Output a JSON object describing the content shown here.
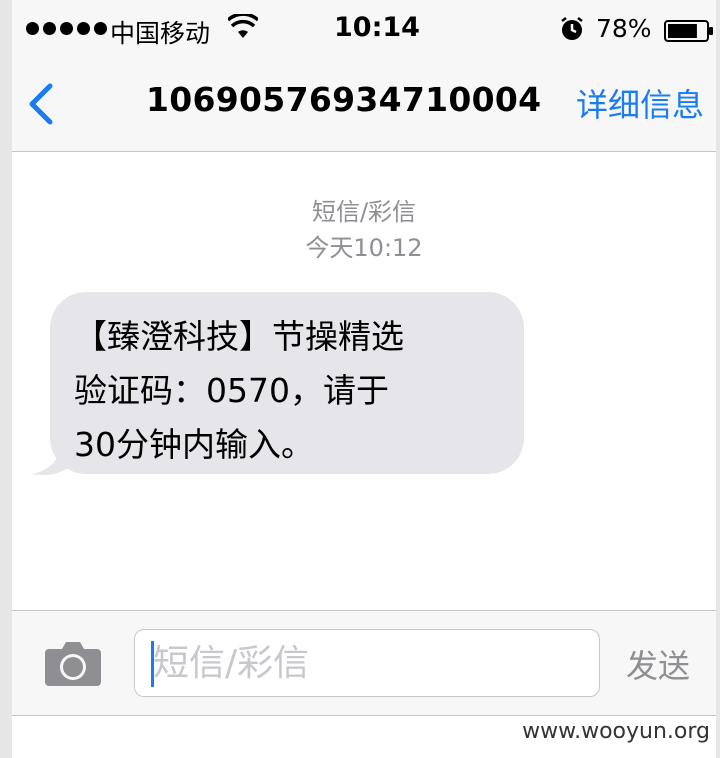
{
  "status_bar": {
    "carrier": "中国移动",
    "time": "10:14",
    "battery_percent": "78%",
    "battery_level": 0.78,
    "icons": [
      "signal-dots-icon",
      "wifi-icon",
      "alarm-icon",
      "battery-icon"
    ]
  },
  "nav": {
    "back_icon": "chevron-left-icon",
    "title": "10690576934710004",
    "details_label": "详细信息"
  },
  "conversation": {
    "message_type": "短信/彩信",
    "timestamp": "今天10:12",
    "message_text": "【臻澄科技】节操精选\n验证码：0570，请于\n30分钟内输入。"
  },
  "input_bar": {
    "camera_icon": "camera-icon",
    "placeholder": "短信/彩信",
    "send_label": "发送"
  },
  "watermark": "www.wooyun.org",
  "colors": {
    "accent": "#1a7cf4",
    "bubble": "#e5e5ea",
    "bar_bg": "#f7f7f7",
    "secondary_text": "#8e8e93"
  }
}
